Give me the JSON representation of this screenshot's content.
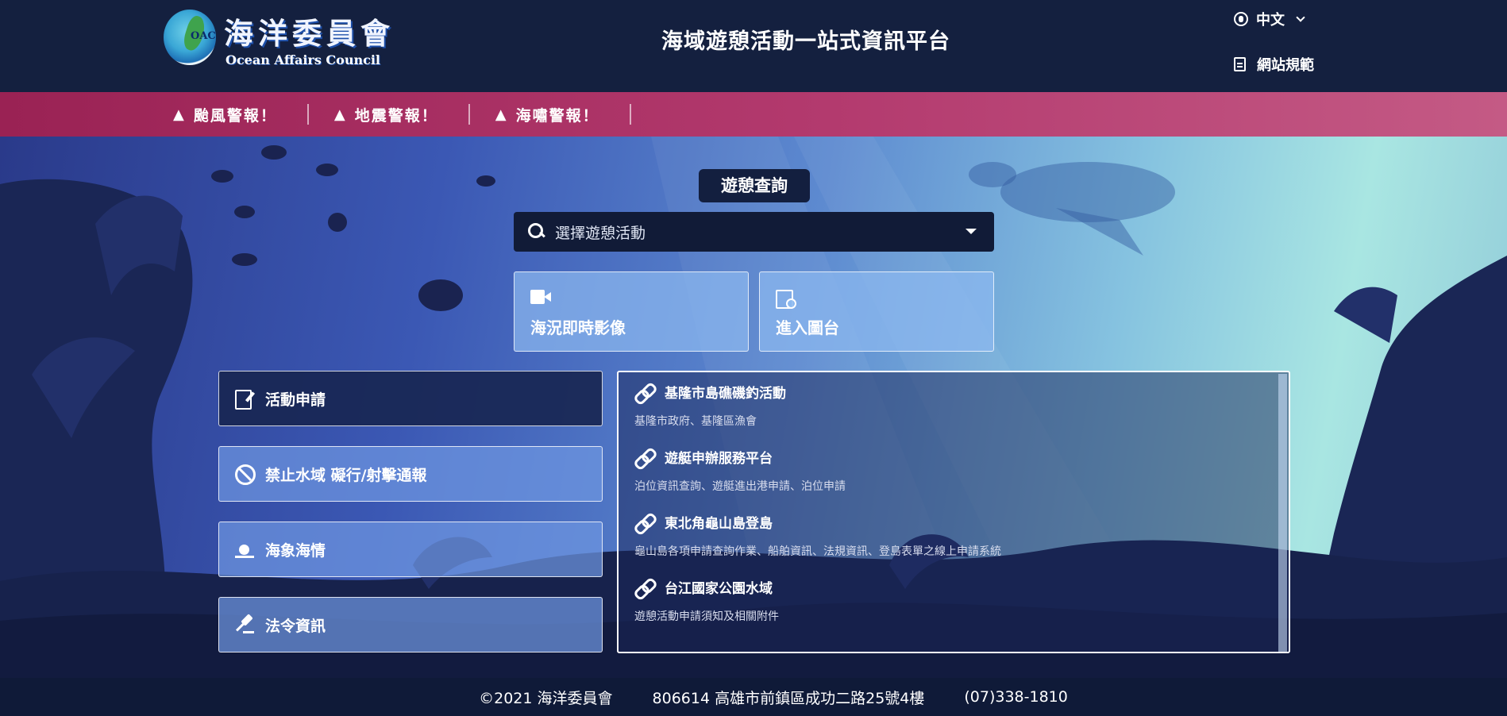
{
  "header": {
    "logo_title": "海洋委員會",
    "logo_subtitle": "Ocean Affairs Council",
    "logo_mark": "OAC",
    "site_title": "海域遊憩活動一站式資訊平台",
    "language_label": "中文",
    "sitemap_label": "網站規範",
    "background": "#14203f"
  },
  "alerts": [
    {
      "label": "颱風警報！",
      "icon": "warning-icon"
    },
    {
      "label": "地震警報！",
      "icon": "warning-icon"
    },
    {
      "label": "海嘯警報！",
      "icon": "warning-icon"
    }
  ],
  "query": {
    "tag_label": "遊憩查詢",
    "select_placeholder": "選擇遊憩活動"
  },
  "tiles": [
    {
      "label": "海況即時影像",
      "icon": "video-camera-icon"
    },
    {
      "label": "進入圖台",
      "icon": "map-search-icon"
    }
  ],
  "side_buttons": [
    {
      "label": "活動申請",
      "icon": "edit-document-icon"
    },
    {
      "label": "禁止水域 礙行/射擊通報",
      "icon": "block-icon"
    },
    {
      "label": "海象海情",
      "icon": "sunrise-icon"
    },
    {
      "label": "法令資訊",
      "icon": "gavel-icon"
    }
  ],
  "links": [
    {
      "title": "基隆市島礁磯釣活動",
      "desc": "基隆市政府、基隆區漁會"
    },
    {
      "title": "遊艇申辦服務平台",
      "desc": "泊位資訊查詢、遊艇進出港申請、泊位申請"
    },
    {
      "title": "東北角龜山島登島",
      "desc": "龜山島各項申請查詢作業、船舶資訊、法規資訊、登島表單之線上申請系統"
    },
    {
      "title": "台江國家公園水域",
      "desc": "遊憩活動申請須知及相關附件"
    }
  ],
  "footer": {
    "copyright": "©2021 海洋委員會",
    "address": "806614 高雄市前鎮區成功二路25號4樓",
    "phone": "(07)338-1810"
  },
  "colors": {
    "alert_bar": "#9a2254",
    "navy": "#14203f",
    "tile_blue": "#8cb9f0"
  }
}
